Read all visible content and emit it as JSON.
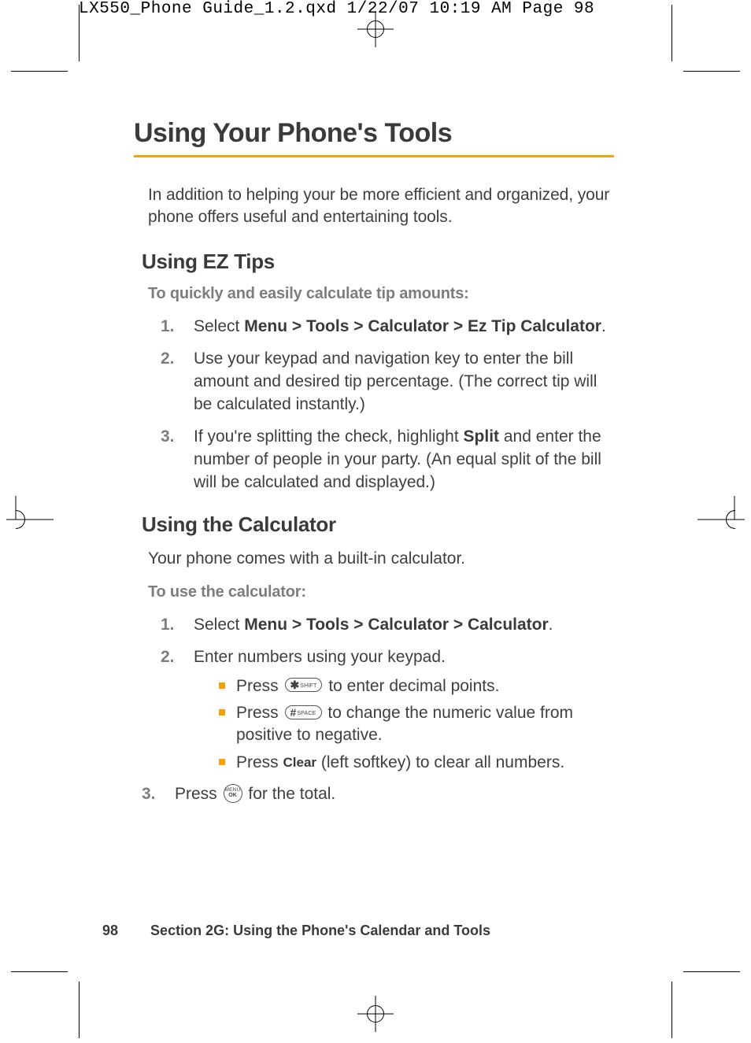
{
  "slug": "LX550_Phone Guide_1.2.qxd  1/22/07  10:19 AM  Page 98",
  "title": "Using Your Phone's Tools",
  "intro": "In addition to helping your be more efficient and organized, your phone offers useful and entertaining tools.",
  "eztips": {
    "heading": "Using EZ Tips",
    "lead": "To quickly and easily calculate tip amounts:",
    "steps": [
      {
        "num": "1.",
        "pre": "Select ",
        "bold": "Menu > Tools > Calculator > Ez Tip Calculator",
        "post": "."
      },
      {
        "num": "2.",
        "text": "Use your keypad and navigation key to enter the bill amount and desired tip percentage. (The correct tip will be calculated instantly.)"
      },
      {
        "num": "3.",
        "pre": "If you're splitting the check, highlight ",
        "bold": "Split",
        "post": " and enter the number of people in your party. (An equal split of the bill will be calculated and displayed.)"
      }
    ]
  },
  "calc": {
    "heading": "Using the Calculator",
    "intro": "Your phone comes with a built-in calculator.",
    "lead": "To use the calculator:",
    "steps": [
      {
        "num": "1.",
        "pre": "Select ",
        "bold": "Menu > Tools > Calculator > Calculator",
        "post": "."
      },
      {
        "num": "2.",
        "text": "Enter numbers using your keypad.",
        "bullets": [
          {
            "pre": "Press ",
            "key": "star",
            "post": " to enter decimal points."
          },
          {
            "pre": "Press ",
            "key": "pound",
            "post": " to change the numeric value from positive to negative."
          },
          {
            "pre": "Press ",
            "smallbold": "Clear",
            "post": " (left softkey) to clear all numbers."
          }
        ]
      },
      {
        "num": "3.",
        "pre": "Press ",
        "key": "ok",
        "post": " for the total."
      }
    ]
  },
  "keys": {
    "star": {
      "big": "✱",
      "tiny": "SHIFT"
    },
    "pound": {
      "big": "#",
      "tiny": "SPACE"
    },
    "ok": {
      "t1": "MENU",
      "t2": "OK"
    }
  },
  "footer": {
    "page": "98",
    "section": "Section 2G: Using the Phone's Calendar and Tools"
  }
}
